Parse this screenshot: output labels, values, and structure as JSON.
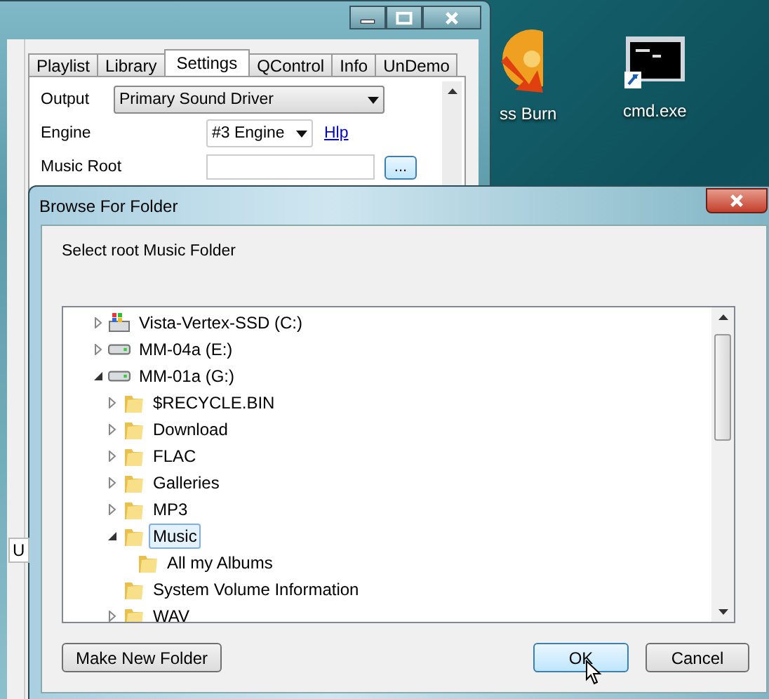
{
  "desktop_icons": [
    {
      "kind": "burn",
      "label": "ss Burn"
    },
    {
      "kind": "console",
      "label": "cmd.exe"
    }
  ],
  "back_window": {
    "tabs": [
      {
        "label": "Playlist",
        "selected": false
      },
      {
        "label": "Library",
        "selected": false
      },
      {
        "label": "Settings",
        "selected": true
      },
      {
        "label": "QControl",
        "selected": false
      },
      {
        "label": "Info",
        "selected": false
      },
      {
        "label": "UnDemo",
        "selected": false
      }
    ],
    "output": {
      "label": "Output",
      "value": "Primary Sound Driver"
    },
    "engine": {
      "label": "Engine",
      "value": "#3 Engine",
      "help_link": "Hlp"
    },
    "music_root": {
      "label": "Music Root",
      "browse_button": "..."
    },
    "side_fragment": "U"
  },
  "dialog": {
    "title": "Browse For Folder",
    "prompt": "Select root Music Folder",
    "tree": [
      {
        "label": "Vista-Vertex-SSD (C:)",
        "kind": "system-drive",
        "expanded": false,
        "selected": false
      },
      {
        "label": "MM-04a (E:)",
        "kind": "drive",
        "expanded": false,
        "selected": false
      },
      {
        "label": "MM-01a (G:)",
        "kind": "drive",
        "expanded": true,
        "selected": false,
        "children": [
          {
            "label": "$RECYCLE.BIN",
            "kind": "folder",
            "expanded": false,
            "selected": false
          },
          {
            "label": "Download",
            "kind": "folder",
            "expanded": false,
            "selected": false
          },
          {
            "label": "FLAC",
            "kind": "folder",
            "expanded": false,
            "selected": false
          },
          {
            "label": "Galleries",
            "kind": "folder",
            "expanded": false,
            "selected": false
          },
          {
            "label": "MP3",
            "kind": "folder",
            "expanded": false,
            "selected": false
          },
          {
            "label": "Music",
            "kind": "folder",
            "expanded": true,
            "selected": true,
            "children": [
              {
                "label": "All my Albums",
                "kind": "folder",
                "selected": false
              }
            ]
          },
          {
            "label": "System Volume Information",
            "kind": "folder",
            "selected": false
          },
          {
            "label": "WAV",
            "kind": "folder",
            "expanded": false,
            "selected": false
          }
        ]
      }
    ],
    "buttons": [
      {
        "label": "Make New Folder",
        "kind": "plain"
      },
      {
        "label": "OK",
        "kind": "default"
      },
      {
        "label": "Cancel",
        "kind": "plain"
      }
    ]
  }
}
